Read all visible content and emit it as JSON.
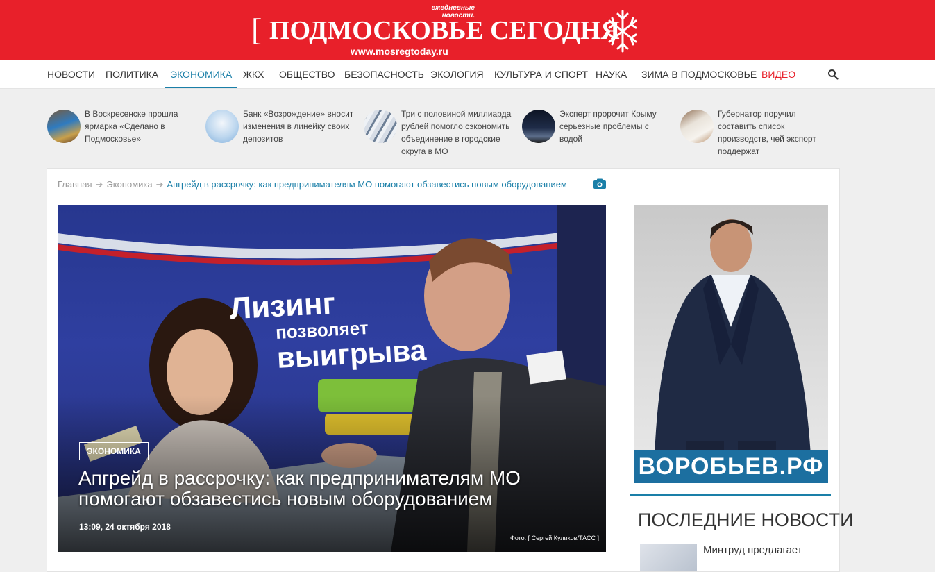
{
  "header": {
    "bracket": "[",
    "title": "ПОДМОСКОВЬЕ СЕГОДНЯ",
    "tagline": "ежедневные новости.",
    "url": "www.mosregtoday.ru",
    "brand_color": "#e8202a"
  },
  "nav": {
    "items": [
      {
        "label": "НОВОСТИ"
      },
      {
        "label": "ПОЛИТИКА"
      },
      {
        "label": "ЭКОНОМИКА",
        "active": true
      },
      {
        "label": "ЖКХ"
      },
      {
        "label": "ОБЩЕСТВО"
      },
      {
        "label": "БЕЗОПАСНОСТЬ"
      },
      {
        "label": "ЭКОЛОГИЯ"
      },
      {
        "label": "КУЛЬТУРА И СПОРТ"
      },
      {
        "label": "НАУКА"
      },
      {
        "label": "ЗИМА В ПОДМОСКОВЬЕ"
      },
      {
        "label": "ВИДЕО"
      }
    ],
    "search_icon": "search-icon",
    "accent_color": "#1a7fa8"
  },
  "related": [
    {
      "text": "В Воскресенске прошла ярмарка «Сделано в Подмосковье»"
    },
    {
      "text": "Банк «Возрождение» вносит изменения в линейку своих депозитов"
    },
    {
      "text": "Три с половиной миллиарда рублей помогло сэкономить объединение в городские округа в МО"
    },
    {
      "text": "Эксперт пророчит Крыму серьезные проблемы с водой"
    },
    {
      "text": "Губернатор поручил составить список производств, чей экспорт поддержат"
    }
  ],
  "breadcrumb": {
    "home": "Главная",
    "section": "Экономика",
    "current": "Апгрейд в рассрочку: как предпринимателям МО помогают обзавестись новым оборудованием",
    "camera_icon": "camera-icon"
  },
  "article": {
    "category": "ЭКОНОМИКА",
    "title": "Апгрейд в рассрочку: как предпринимателям МО помогают обзавестись новым оборудованием",
    "date": "13:09, 24 октября 2018",
    "photo_credit": "Фото: [ Сергей Куликов/ТАСС ]",
    "banner_line1": "Лизинг",
    "banner_line2": "позволяет",
    "banner_line3": "выигрыва"
  },
  "sidebar": {
    "ad_label": "ВОРОБЬЕВ.РФ",
    "latest_title": "ПОСЛЕДНИЕ НОВОСТИ",
    "latest_items": [
      {
        "text": "Минтруд предлагает"
      }
    ]
  }
}
